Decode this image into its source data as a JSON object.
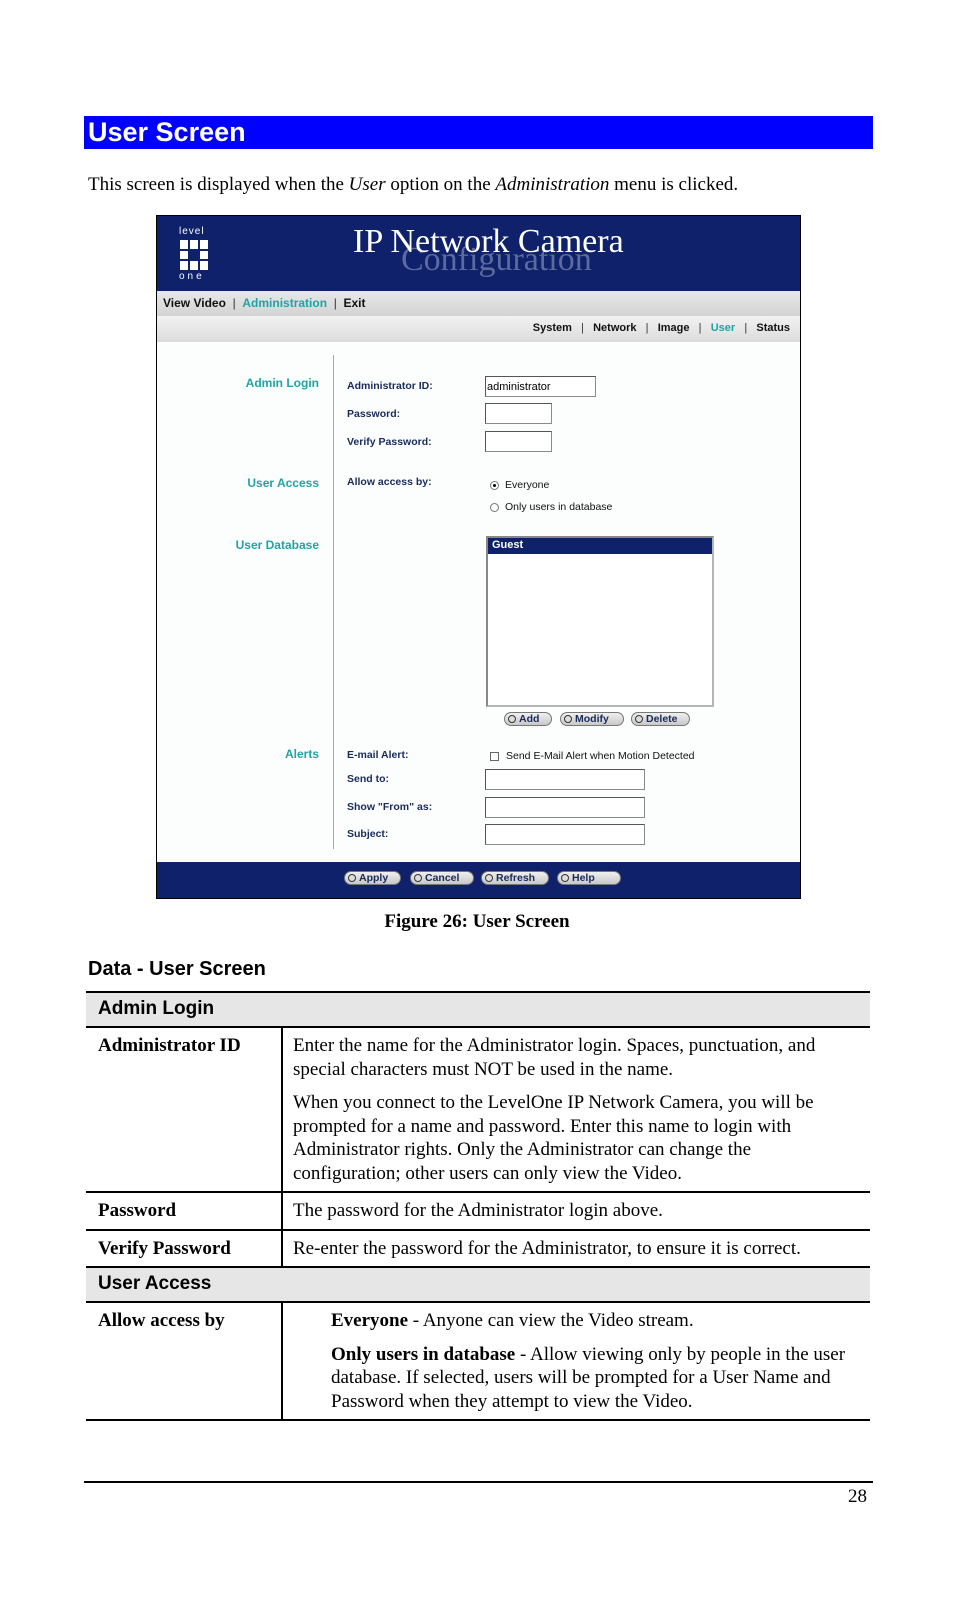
{
  "section_title": "User Screen",
  "intro": {
    "before": "This screen is displayed when the ",
    "em1": "User",
    "middle": " option on the ",
    "em2": "Administration",
    "after": " menu is clicked."
  },
  "screenshot": {
    "logo": {
      "top": "level",
      "bottom": "one"
    },
    "title": "IP Network Camera",
    "subtitle": "Configuration",
    "main_nav": [
      {
        "label": "View Video",
        "active": false
      },
      {
        "label": "Administration",
        "active": true
      },
      {
        "label": "Exit",
        "active": false
      }
    ],
    "sub_nav": [
      {
        "label": "System",
        "active": false
      },
      {
        "label": "Network",
        "active": false
      },
      {
        "label": "Image",
        "active": false
      },
      {
        "label": "User",
        "active": true
      },
      {
        "label": "Status",
        "active": false
      }
    ],
    "separator": "|",
    "sections": {
      "admin_login": "Admin Login",
      "user_access": "User Access",
      "user_database": "User Database",
      "alerts": "Alerts"
    },
    "fields": {
      "admin_id_label": "Administrator ID:",
      "admin_id_value": "administrator",
      "password_label": "Password:",
      "password_value": "",
      "verify_label": "Verify Password:",
      "verify_value": "",
      "allow_access_label": "Allow access by:",
      "radio_everyone": "Everyone",
      "radio_only_db": "Only users in database",
      "radio_selected": "Everyone",
      "user_list": [
        "Guest"
      ],
      "email_alert_label": "E-mail Alert:",
      "email_alert_checkbox": "Send E-Mail Alert when Motion Detected",
      "email_alert_checked": false,
      "send_to_label": "Send to:",
      "send_to_value": "",
      "from_label": "Show \"From\" as:",
      "from_value": "",
      "subject_label": "Subject:",
      "subject_value": ""
    },
    "db_buttons": {
      "add": "Add",
      "modify": "Modify",
      "delete": "Delete"
    },
    "footer_buttons": {
      "apply": "Apply",
      "cancel": "Cancel",
      "refresh": "Refresh",
      "help": "Help"
    }
  },
  "caption": "Figure 26: User Screen",
  "data_heading": "Data - User Screen",
  "table": {
    "groups": [
      {
        "title": "Admin Login",
        "rows": [
          {
            "name": "Administrator ID",
            "paras": [
              "Enter the name for the Administrator login. Spaces, punctuation, and special characters must NOT be used in the name.",
              "When you connect to the LevelOne IP Network Camera, you will be prompted for a name and password. Enter this name to login with Administrator rights. Only the Administrator can change the configuration; other users can only view the Video."
            ]
          },
          {
            "name": "Password",
            "paras": [
              "The password for the Administrator login above."
            ]
          },
          {
            "name": "Verify Password",
            "paras": [
              "Re-enter the password for the Administrator, to ensure it is correct."
            ]
          }
        ]
      },
      {
        "title": "User Access",
        "rows": [
          {
            "name": "Allow access by",
            "options": [
              {
                "term": "Everyone",
                "desc": " - Anyone can view the Video stream."
              },
              {
                "term": "Only users in database",
                "desc": " - Allow viewing only by people in the user database. If selected, users will be prompted for a User Name and Password when they attempt to view the Video."
              }
            ]
          }
        ]
      }
    ]
  },
  "page_number": "28"
}
